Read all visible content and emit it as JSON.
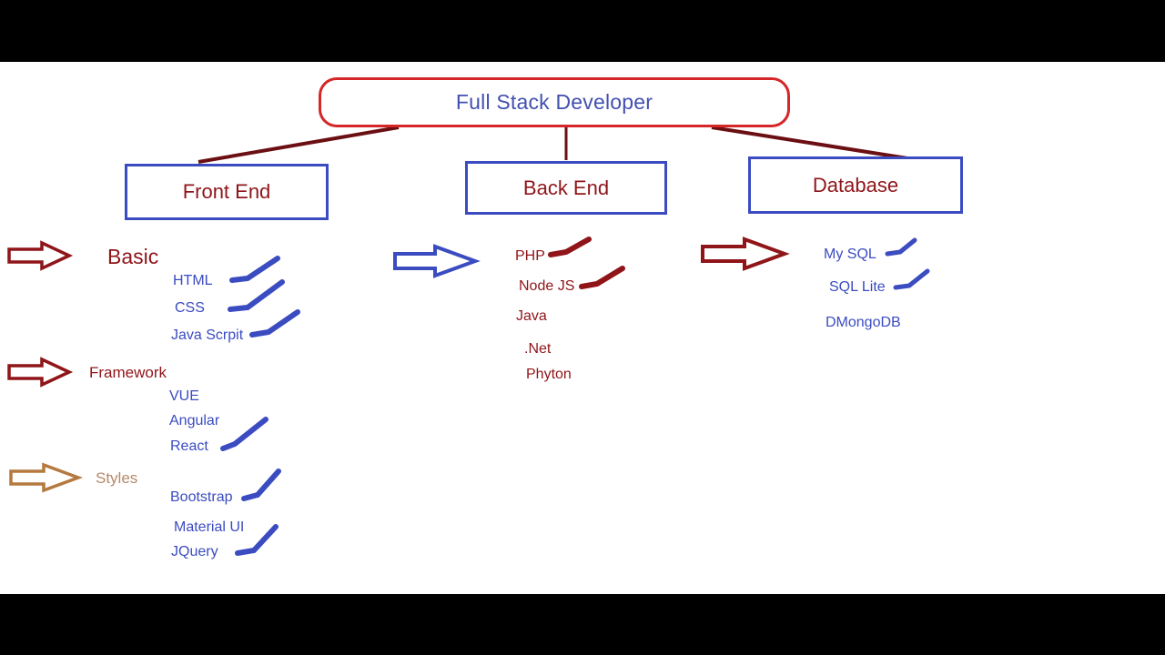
{
  "diagram": {
    "root": {
      "label": "Full Stack Developer",
      "border_color": "#d62728",
      "text_color": "#4350b0"
    },
    "categories": [
      {
        "label": "Front End",
        "box_color": "#3b4cc0",
        "text_color": "#8f1519"
      },
      {
        "label": "Back End",
        "box_color": "#3b4cc0",
        "text_color": "#8f1519"
      },
      {
        "label": "Database",
        "box_color": "#3b4cc0",
        "text_color": "#8f1519"
      }
    ],
    "frontend": {
      "groups": [
        {
          "label": "Basic",
          "arrow_color": "#8f1519",
          "label_color": "#8f1519",
          "items": [
            {
              "label": "HTML",
              "checked": true
            },
            {
              "label": "CSS",
              "checked": true
            },
            {
              "label": "Java Scrpit",
              "checked": true
            }
          ]
        },
        {
          "label": "Framework",
          "arrow_color": "#8f1519",
          "label_color": "#8f1519",
          "items": [
            {
              "label": "VUE",
              "checked": false
            },
            {
              "label": "Angular",
              "checked": false
            },
            {
              "label": "React",
              "checked": true
            }
          ]
        },
        {
          "label": "Styles",
          "arrow_color": "#b5793f",
          "label_color": "#b58a6a",
          "items": [
            {
              "label": "Bootstrap",
              "checked": true
            },
            {
              "label": "Material UI",
              "checked": false
            },
            {
              "label": "JQuery",
              "checked": true
            }
          ]
        }
      ]
    },
    "backend": {
      "arrow_color": "#3b4cc0",
      "item_color": "#8f1519",
      "items": [
        {
          "label": "PHP",
          "checked": true
        },
        {
          "label": "Node JS",
          "checked": true
        },
        {
          "label": "Java",
          "checked": false
        },
        {
          "label": ".Net",
          "checked": false
        },
        {
          "label": "Phyton",
          "checked": false
        }
      ]
    },
    "database": {
      "arrow_color": "#8f1519",
      "item_color": "#3b4cc0",
      "items": [
        {
          "label": "My SQL",
          "checked": true
        },
        {
          "label": "SQL Lite",
          "checked": true
        },
        {
          "label": "DMongoDB",
          "checked": false
        }
      ]
    }
  }
}
